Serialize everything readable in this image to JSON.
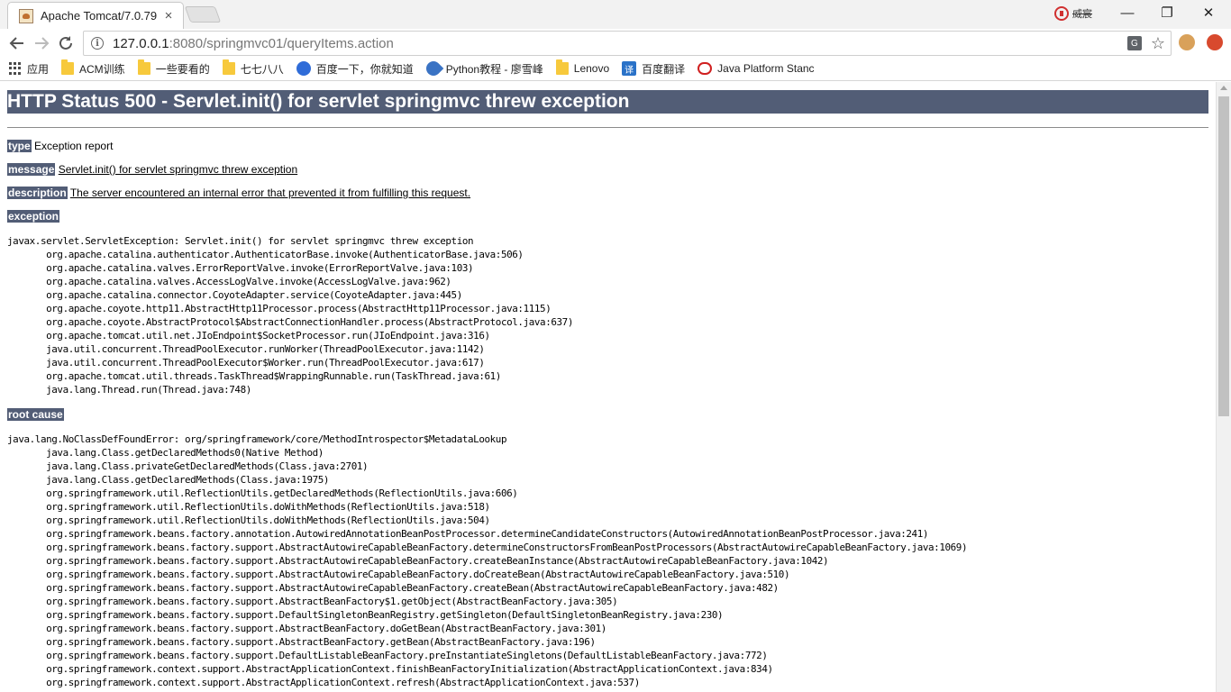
{
  "browser": {
    "tab_title": "Apache Tomcat/7.0.79",
    "tab_close": "×",
    "profile_label": "威宸",
    "window_controls": {
      "minimize": "—",
      "maximize": "❐",
      "close": "✕"
    },
    "url_host": "127.0.0.1",
    "url_path": ":8080/springmvc01/queryItems.action",
    "bookmarks": [
      {
        "label": "应用",
        "icon": "apps-icon"
      },
      {
        "label": "ACM训练",
        "icon": "folder-icon"
      },
      {
        "label": "一些要看的",
        "icon": "folder-icon"
      },
      {
        "label": "七七八八",
        "icon": "folder-icon"
      },
      {
        "label": "百度一下，你就知道",
        "icon": "baidu-paw-icon"
      },
      {
        "label": "Python教程 - 廖雪峰",
        "icon": "rocket-icon"
      },
      {
        "label": "Lenovo",
        "icon": "folder-icon"
      },
      {
        "label": "百度翻译",
        "icon": "baidu-translate-icon"
      },
      {
        "label": "Java Platform Stanc",
        "icon": "oracle-icon"
      }
    ]
  },
  "page": {
    "heading": "HTTP Status 500 - Servlet.init() for servlet springmvc threw exception",
    "type_label": "type",
    "type_value": "Exception report",
    "message_label": "message",
    "message_value": "Servlet.init() for servlet springmvc threw exception",
    "description_label": "description",
    "description_value": "The server encountered an internal error that prevented it from fulfilling this request.",
    "exception_label": "exception",
    "exception_trace": [
      "javax.servlet.ServletException: Servlet.init() for servlet springmvc threw exception",
      "\torg.apache.catalina.authenticator.AuthenticatorBase.invoke(AuthenticatorBase.java:506)",
      "\torg.apache.catalina.valves.ErrorReportValve.invoke(ErrorReportValve.java:103)",
      "\torg.apache.catalina.valves.AccessLogValve.invoke(AccessLogValve.java:962)",
      "\torg.apache.catalina.connector.CoyoteAdapter.service(CoyoteAdapter.java:445)",
      "\torg.apache.coyote.http11.AbstractHttp11Processor.process(AbstractHttp11Processor.java:1115)",
      "\torg.apache.coyote.AbstractProtocol$AbstractConnectionHandler.process(AbstractProtocol.java:637)",
      "\torg.apache.tomcat.util.net.JIoEndpoint$SocketProcessor.run(JIoEndpoint.java:316)",
      "\tjava.util.concurrent.ThreadPoolExecutor.runWorker(ThreadPoolExecutor.java:1142)",
      "\tjava.util.concurrent.ThreadPoolExecutor$Worker.run(ThreadPoolExecutor.java:617)",
      "\torg.apache.tomcat.util.threads.TaskThread$WrappingRunnable.run(TaskThread.java:61)",
      "\tjava.lang.Thread.run(Thread.java:748)"
    ],
    "root_cause_label": "root cause",
    "root_cause_trace": [
      "java.lang.NoClassDefFoundError: org/springframework/core/MethodIntrospector$MetadataLookup",
      "\tjava.lang.Class.getDeclaredMethods0(Native Method)",
      "\tjava.lang.Class.privateGetDeclaredMethods(Class.java:2701)",
      "\tjava.lang.Class.getDeclaredMethods(Class.java:1975)",
      "\torg.springframework.util.ReflectionUtils.getDeclaredMethods(ReflectionUtils.java:606)",
      "\torg.springframework.util.ReflectionUtils.doWithMethods(ReflectionUtils.java:518)",
      "\torg.springframework.util.ReflectionUtils.doWithMethods(ReflectionUtils.java:504)",
      "\torg.springframework.beans.factory.annotation.AutowiredAnnotationBeanPostProcessor.determineCandidateConstructors(AutowiredAnnotationBeanPostProcessor.java:241)",
      "\torg.springframework.beans.factory.support.AbstractAutowireCapableBeanFactory.determineConstructorsFromBeanPostProcessors(AbstractAutowireCapableBeanFactory.java:1069)",
      "\torg.springframework.beans.factory.support.AbstractAutowireCapableBeanFactory.createBeanInstance(AbstractAutowireCapableBeanFactory.java:1042)",
      "\torg.springframework.beans.factory.support.AbstractAutowireCapableBeanFactory.doCreateBean(AbstractAutowireCapableBeanFactory.java:510)",
      "\torg.springframework.beans.factory.support.AbstractAutowireCapableBeanFactory.createBean(AbstractAutowireCapableBeanFactory.java:482)",
      "\torg.springframework.beans.factory.support.AbstractBeanFactory$1.getObject(AbstractBeanFactory.java:305)",
      "\torg.springframework.beans.factory.support.DefaultSingletonBeanRegistry.getSingleton(DefaultSingletonBeanRegistry.java:230)",
      "\torg.springframework.beans.factory.support.AbstractBeanFactory.doGetBean(AbstractBeanFactory.java:301)",
      "\torg.springframework.beans.factory.support.AbstractBeanFactory.getBean(AbstractBeanFactory.java:196)",
      "\torg.springframework.beans.factory.support.DefaultListableBeanFactory.preInstantiateSingletons(DefaultListableBeanFactory.java:772)",
      "\torg.springframework.context.support.AbstractApplicationContext.finishBeanFactoryInitialization(AbstractApplicationContext.java:834)",
      "\torg.springframework.context.support.AbstractApplicationContext.refresh(AbstractApplicationContext.java:537)"
    ]
  }
}
